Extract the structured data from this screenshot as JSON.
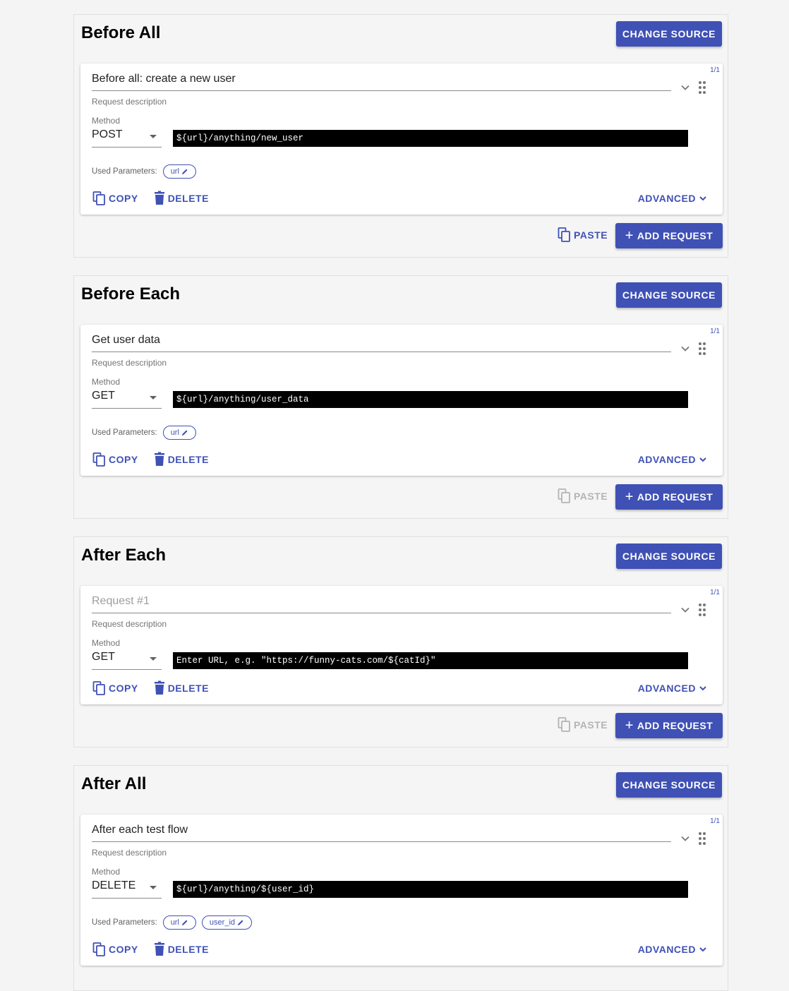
{
  "sections": [
    {
      "title": "Before All",
      "change_source": "CHANGE SOURCE",
      "counter": "1/1",
      "request_title": "Before all: create a new user",
      "request_description": "Request description",
      "method_label": "Method",
      "method": "POST",
      "url": "${url}/anything/new_user",
      "used_parameters_label": "Used Parameters:",
      "params": [
        "url"
      ],
      "copy": "COPY",
      "delete": "DELETE",
      "advanced": "ADVANCED",
      "paste": "PASTE",
      "paste_enabled": true,
      "add_request": "ADD REQUEST"
    },
    {
      "title": "Before Each",
      "change_source": "CHANGE SOURCE",
      "counter": "1/1",
      "request_title": "Get user data",
      "request_description": "Request description",
      "method_label": "Method",
      "method": "GET",
      "url": "${url}/anything/user_data",
      "used_parameters_label": "Used Parameters:",
      "params": [
        "url"
      ],
      "copy": "COPY",
      "delete": "DELETE",
      "advanced": "ADVANCED",
      "paste": "PASTE",
      "paste_enabled": false,
      "add_request": "ADD REQUEST"
    },
    {
      "title": "After Each",
      "change_source": "CHANGE SOURCE",
      "counter": "1/1",
      "request_title_placeholder": "Request #1",
      "request_description": "Request description",
      "method_label": "Method",
      "method": "GET",
      "url_placeholder": "Enter URL, e.g. \"https://funny-cats.com/${catId}\"",
      "copy": "COPY",
      "delete": "DELETE",
      "advanced": "ADVANCED",
      "paste": "PASTE",
      "paste_enabled": false,
      "add_request": "ADD REQUEST"
    },
    {
      "title": "After All",
      "change_source": "CHANGE SOURCE",
      "counter": "1/1",
      "request_title": "After each test flow",
      "request_description": "Request description",
      "method_label": "Method",
      "method": "DELETE",
      "url": "${url}/anything/${user_id}",
      "used_parameters_label": "Used Parameters:",
      "params": [
        "url",
        "user_id"
      ],
      "copy": "COPY",
      "delete": "DELETE",
      "advanced": "ADVANCED"
    }
  ],
  "colors": {
    "accent": "#3f51b5",
    "disabled": "#b4b4b4",
    "url_bg": "#000000"
  },
  "icons": [
    "chevron-down-icon",
    "drag-handle-icon",
    "pencil-icon",
    "copy-icon",
    "trash-icon",
    "plus-icon",
    "paste-icon"
  ]
}
